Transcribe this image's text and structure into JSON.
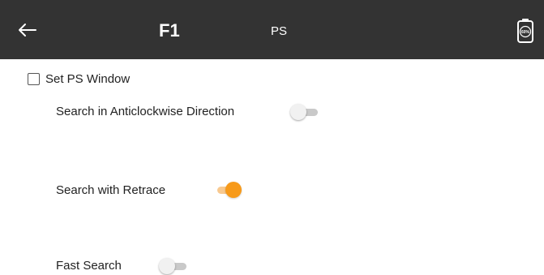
{
  "header": {
    "back_icon": "arrow-left-icon",
    "title": "F1",
    "subtitle": "PS",
    "battery_icon": "battery-icon",
    "battery_level": "60%",
    "background": "#333333"
  },
  "settings": {
    "set_ps_window": {
      "label": "Set PS Window",
      "checked": false
    },
    "anticlockwise": {
      "label": "Search in Anticlockwise Direction",
      "enabled": false
    },
    "retrace": {
      "label": "Search with Retrace",
      "enabled": true
    },
    "fast_search": {
      "label": "Fast Search",
      "enabled": false
    }
  },
  "colors": {
    "accent": "#f79a1a",
    "accent_track": "#f8c98f"
  }
}
